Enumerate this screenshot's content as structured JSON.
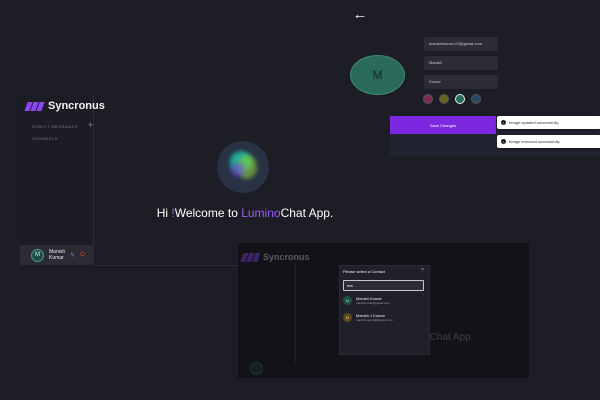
{
  "sidebar": {
    "brand": "Syncronus",
    "direct_messages_label": "DIRECT MESSAGES",
    "channels_label": "CHANNELS",
    "add_icon": "plus-icon",
    "profile": {
      "avatar_initial": "M",
      "first_name": "Manish",
      "last_name": "Kumar"
    }
  },
  "welcome": {
    "prefix": "Hi ",
    "exclaim": "!",
    "before_brand": "Welcome to ",
    "brand_accent": "Lumino",
    "brand_rest": "Chat App."
  },
  "profile_edit": {
    "back_icon": "arrow-left-icon",
    "avatar_initial": "M",
    "email_value": "manishkumar123@gmail.com",
    "first_name_value": "Manish",
    "last_name_value": "Kumar",
    "color_options": [
      "#7a2d55",
      "#6b6320",
      "#2a6a5a",
      "#2a4a62"
    ],
    "save_label": "Save Changes"
  },
  "toasts": [
    {
      "text": "Image updated successfully."
    },
    {
      "text": "Image removed successfully."
    }
  ],
  "modal": {
    "title": "Please select a Contact",
    "search_value": "ma",
    "contacts": [
      {
        "initial": "M",
        "name": "Manish Kumar",
        "email": "manish.main@gmail.com",
        "color": "#1f4f45",
        "fg": "#8fd6c2"
      },
      {
        "initial": "M",
        "name": "Manish J Kumar",
        "email": "manish.second@gmail.com",
        "color": "#5a4a1c",
        "fg": "#e8d18a"
      }
    ]
  },
  "background": {
    "brand": "Syncronus",
    "welcome_tail": "Chat App.",
    "welcome_accent_tail": "o"
  },
  "colors": {
    "accent": "#9b5cf6",
    "button": "#7c28e0",
    "background": "#1c1d25"
  }
}
